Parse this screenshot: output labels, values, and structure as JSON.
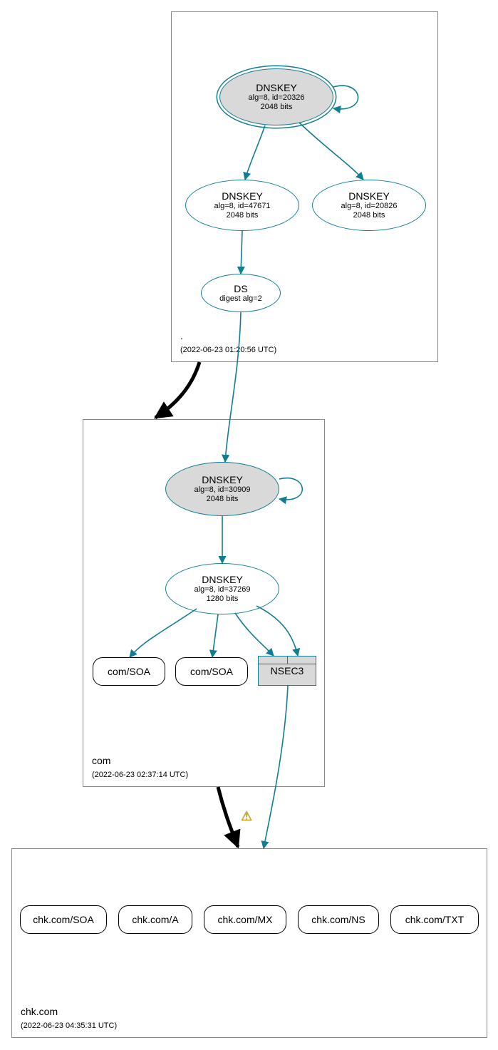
{
  "chart_data": {
    "type": "graph",
    "zones": [
      {
        "id": "root",
        "name": ".",
        "timestamp": "(2022-06-23 01:20:56 UTC)"
      },
      {
        "id": "com",
        "name": "com",
        "timestamp": "(2022-06-23 02:37:14 UTC)"
      },
      {
        "id": "chkcom",
        "name": "chk.com",
        "timestamp": "(2022-06-23 04:35:31 UTC)"
      }
    ],
    "nodes": {
      "root_ksk": {
        "title": "DNSKEY",
        "line2": "alg=8, id=20326",
        "line3": "2048 bits"
      },
      "root_zsk1": {
        "title": "DNSKEY",
        "line2": "alg=8, id=47671",
        "line3": "2048 bits"
      },
      "root_zsk2": {
        "title": "DNSKEY",
        "line2": "alg=8, id=20826",
        "line3": "2048 bits"
      },
      "root_ds": {
        "title": "DS",
        "line2": "digest alg=2"
      },
      "com_ksk": {
        "title": "DNSKEY",
        "line2": "alg=8, id=30909",
        "line3": "2048 bits"
      },
      "com_zsk": {
        "title": "DNSKEY",
        "line2": "alg=8, id=37269",
        "line3": "1280 bits"
      },
      "com_soa1": {
        "label": "com/SOA"
      },
      "com_soa2": {
        "label": "com/SOA"
      },
      "com_nsec3": {
        "label": "NSEC3"
      },
      "chk_soa": {
        "label": "chk.com/SOA"
      },
      "chk_a": {
        "label": "chk.com/A"
      },
      "chk_mx": {
        "label": "chk.com/MX"
      },
      "chk_ns": {
        "label": "chk.com/NS"
      },
      "chk_txt": {
        "label": "chk.com/TXT"
      }
    },
    "edges": [
      {
        "from": "root_ksk",
        "to": "root_ksk",
        "style": "teal",
        "self": true
      },
      {
        "from": "root_ksk",
        "to": "root_zsk1",
        "style": "teal"
      },
      {
        "from": "root_ksk",
        "to": "root_zsk2",
        "style": "teal"
      },
      {
        "from": "root_zsk1",
        "to": "root_ds",
        "style": "teal"
      },
      {
        "from": "root_ds",
        "to": "com_ksk",
        "style": "teal"
      },
      {
        "from": "root",
        "to": "com",
        "style": "black-thick"
      },
      {
        "from": "com_ksk",
        "to": "com_ksk",
        "style": "teal",
        "self": true
      },
      {
        "from": "com_ksk",
        "to": "com_zsk",
        "style": "teal"
      },
      {
        "from": "com_zsk",
        "to": "com_soa1",
        "style": "teal"
      },
      {
        "from": "com_zsk",
        "to": "com_soa2",
        "style": "teal"
      },
      {
        "from": "com_zsk",
        "to": "com_nsec3",
        "style": "teal"
      },
      {
        "from": "com_zsk",
        "to": "com_nsec3",
        "style": "teal"
      },
      {
        "from": "com_nsec3",
        "to": "chkcom",
        "style": "teal"
      },
      {
        "from": "com",
        "to": "chkcom",
        "style": "black-thick",
        "warning": true
      }
    ],
    "warning_icon": "⚠"
  }
}
